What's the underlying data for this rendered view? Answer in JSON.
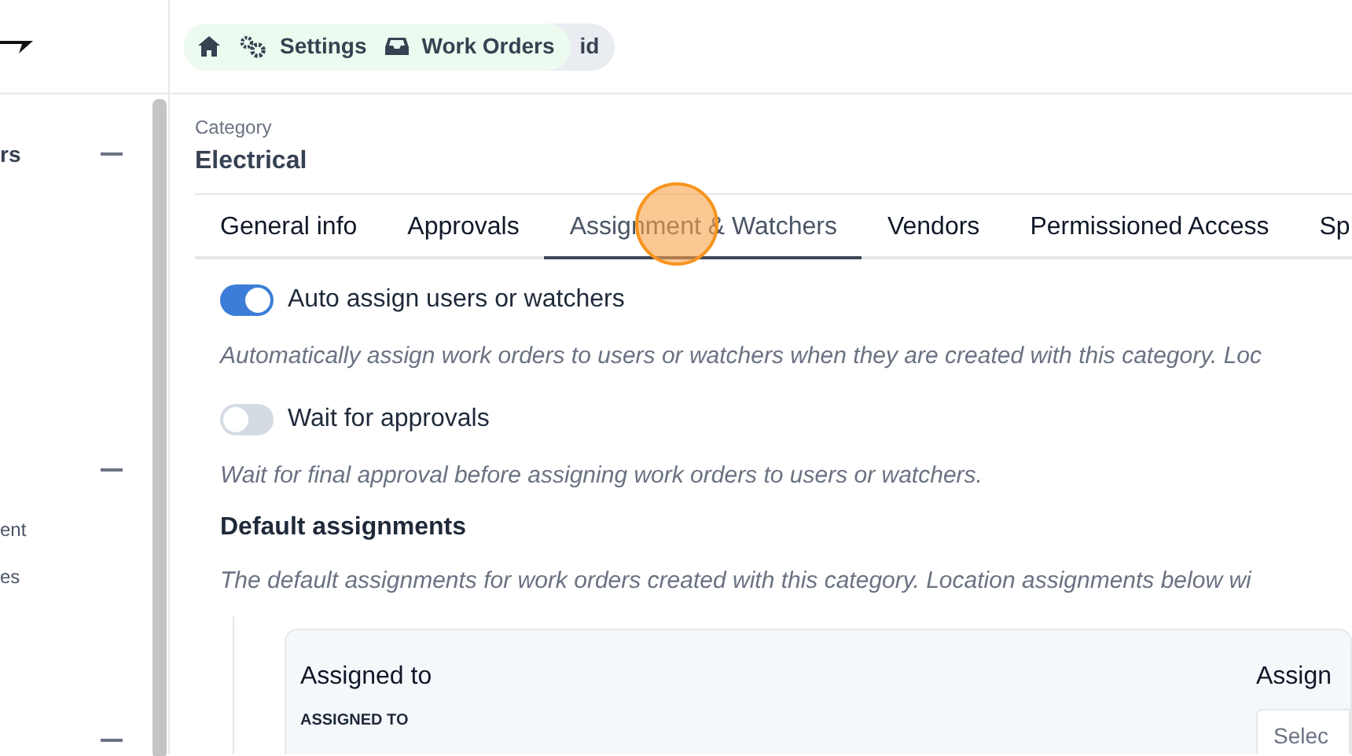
{
  "breadcrumbs": [
    {
      "kind": "home"
    },
    {
      "kind": "gears",
      "label": "Settings"
    },
    {
      "kind": "inbox",
      "label": "Work Orders"
    },
    {
      "kind": "plain",
      "label": "id"
    }
  ],
  "sidebar": {
    "items": [
      {
        "label": "rs",
        "bold": true
      },
      {
        "label": "ent",
        "bold": false
      },
      {
        "label": "es",
        "bold": false
      }
    ]
  },
  "category": {
    "label": "Category",
    "value": "Electrical"
  },
  "tabs": [
    {
      "label": "General info",
      "selected": false
    },
    {
      "label": "Approvals",
      "selected": false
    },
    {
      "label": "Assignment & Watchers",
      "selected": true
    },
    {
      "label": "Vendors",
      "selected": false
    },
    {
      "label": "Permissioned Access",
      "selected": false
    },
    {
      "label": "Sp",
      "selected": false
    }
  ],
  "settings": [
    {
      "label": "Auto assign users or watchers",
      "on": true,
      "description": "Automatically assign work orders to users or watchers when they are created with this category. Loc"
    },
    {
      "label": "Wait for approvals",
      "on": false,
      "description": "Wait for final approval before assigning work orders to users or watchers."
    }
  ],
  "default_assignments": {
    "title": "Default assignments",
    "description": "The default assignments for work orders created with this category. Location assignments below wi",
    "card": {
      "title": "Assigned to",
      "field_label": "ASSIGNED TO",
      "column_2_title": "Assign",
      "select_placeholder": "Selec"
    }
  }
}
